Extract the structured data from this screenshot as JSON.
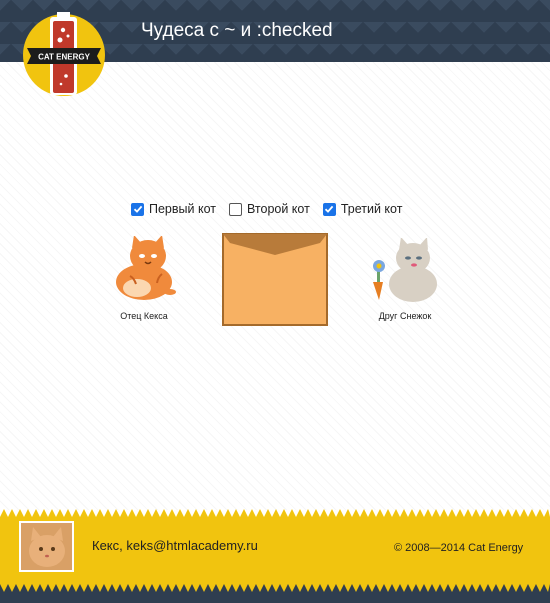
{
  "header": {
    "title": "Чудеса с ~ и :checked",
    "logo_text": "CAT ENERGY"
  },
  "checkboxes": [
    {
      "label": "Первый кот",
      "checked": true
    },
    {
      "label": "Второй кот",
      "checked": false
    },
    {
      "label": "Третий кот",
      "checked": true
    }
  ],
  "cats": {
    "first_caption": "Отец Кекса",
    "third_caption": "Друг Снежок"
  },
  "footer": {
    "contact": "Кекс, keks@htmlacademy.ru",
    "copyright": "© 2008—2014 Cat Energy"
  },
  "colors": {
    "header_bg": "#2f3e50",
    "footer_yellow": "#f1c40f",
    "accent_checkbox": "#1a73e8",
    "envelope": "#f7b163"
  },
  "icons": [
    "cat-energy-logo-icon",
    "orange-cat-icon",
    "envelope-icon",
    "grey-cat-with-flower-icon",
    "cat-avatar-icon"
  ]
}
